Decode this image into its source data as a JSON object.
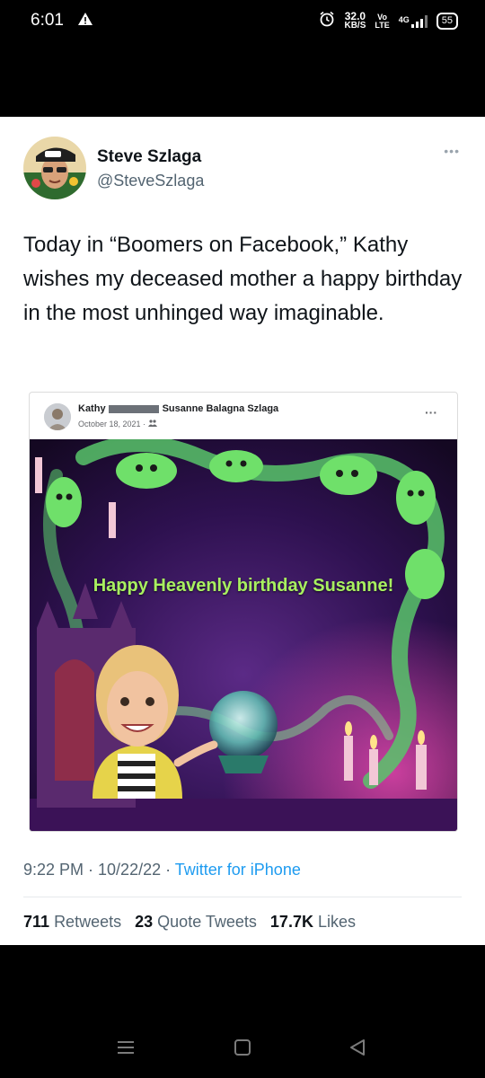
{
  "status_bar": {
    "time": "6:01",
    "speed_value": "32.0",
    "speed_unit": "KB/S",
    "volte_top": "Vo",
    "volte_bottom": "LTE",
    "network": "4G",
    "battery": "55"
  },
  "tweet": {
    "author_name": "Steve Szlaga",
    "author_handle": "@SteveSzlaga",
    "text": "Today in “Boomers on Facebook,” Kathy wishes my deceased mother a happy birthday in the most unhinged way imaginable.",
    "timestamp": "9:22 PM · 10/22/22 ·",
    "source": "Twitter for iPhone",
    "retweets_count": "711",
    "retweets_label": "Retweets",
    "quote_count": "23",
    "quote_label": "Quote Tweets",
    "likes_count": "17.7K",
    "likes_label": "Likes"
  },
  "facebook_post": {
    "poster_name": "Kathy",
    "recipient_name": "Susanne Balagna Szlaga",
    "date": "October 18, 2021 ·",
    "image_caption": "Happy Heavenly birthday Susanne!"
  },
  "icons": {
    "status_warning": "warning-icon",
    "alarm": "alarm-icon",
    "signal": "signal-icon",
    "battery": "battery-icon",
    "tweet_more": "more-horizontal-icon",
    "post_more": "more-horizontal-icon",
    "audience": "friends-icon",
    "nav_recents": "recents-icon",
    "nav_home": "home-icon",
    "nav_back": "back-icon"
  },
  "colors": {
    "accent_link": "#1d9bf0",
    "caption_green": "#a8f060",
    "art_background": "#2a0f4a"
  }
}
